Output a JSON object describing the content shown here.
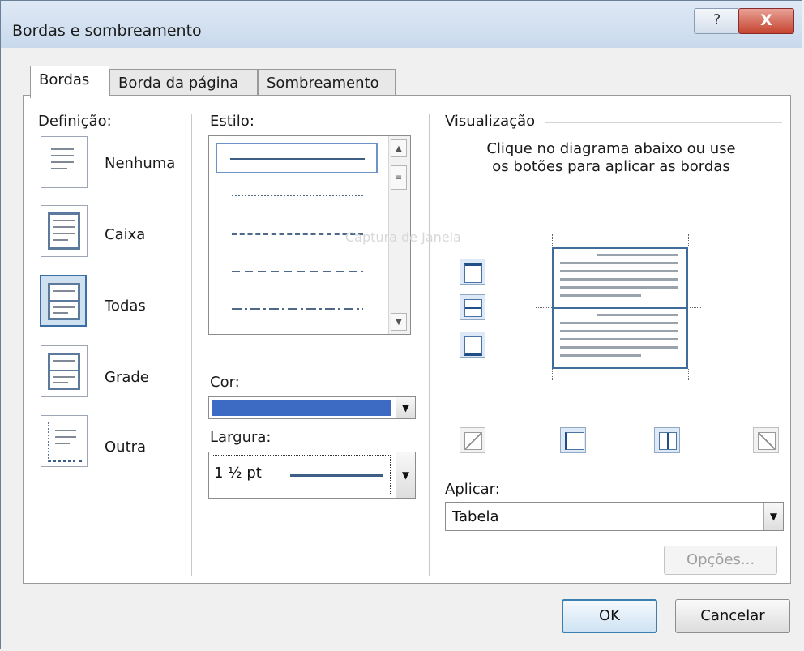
{
  "window": {
    "title": "Bordas e sombreamento"
  },
  "titlebar": {
    "help_glyph": "?",
    "close_glyph": "X"
  },
  "tabs": [
    {
      "label": "Bordas",
      "active": true
    },
    {
      "label": "Borda da página",
      "active": false
    },
    {
      "label": "Sombreamento",
      "active": false
    }
  ],
  "settings": {
    "heading": "Definição:",
    "items": [
      {
        "label": "Nenhuma",
        "icon": "none-setting-icon",
        "selected": false
      },
      {
        "label": "Caixa",
        "icon": "box-setting-icon",
        "selected": false
      },
      {
        "label": "Todas",
        "icon": "all-setting-icon",
        "selected": true
      },
      {
        "label": "Grade",
        "icon": "grid-setting-icon",
        "selected": false
      },
      {
        "label": "Outra",
        "icon": "custom-setting-icon",
        "selected": false
      }
    ]
  },
  "style": {
    "heading": "Estilo:",
    "options": [
      "solid",
      "dotted",
      "fine-dashed",
      "dashed",
      "dash-dot"
    ],
    "selected": "solid"
  },
  "color": {
    "label": "Cor:",
    "value_hex": "#3d6bc4"
  },
  "width": {
    "label": "Largura:",
    "value": "1 ½ pt"
  },
  "preview": {
    "heading": "Visualização",
    "instructions": "Clique no diagrama abaixo ou use os botões para aplicar as bordas",
    "watermark": "Captura de Janela"
  },
  "apply": {
    "label": "Aplicar:",
    "value": "Tabela"
  },
  "options_button": "Opções...",
  "ok_button": "OK",
  "cancel_button": "Cancelar",
  "colors": {
    "accent": "#3c7fb1",
    "border_blue": "#4b74a2",
    "panel_bg": "#ffffff",
    "dialog_bg": "#f0f0f0"
  }
}
